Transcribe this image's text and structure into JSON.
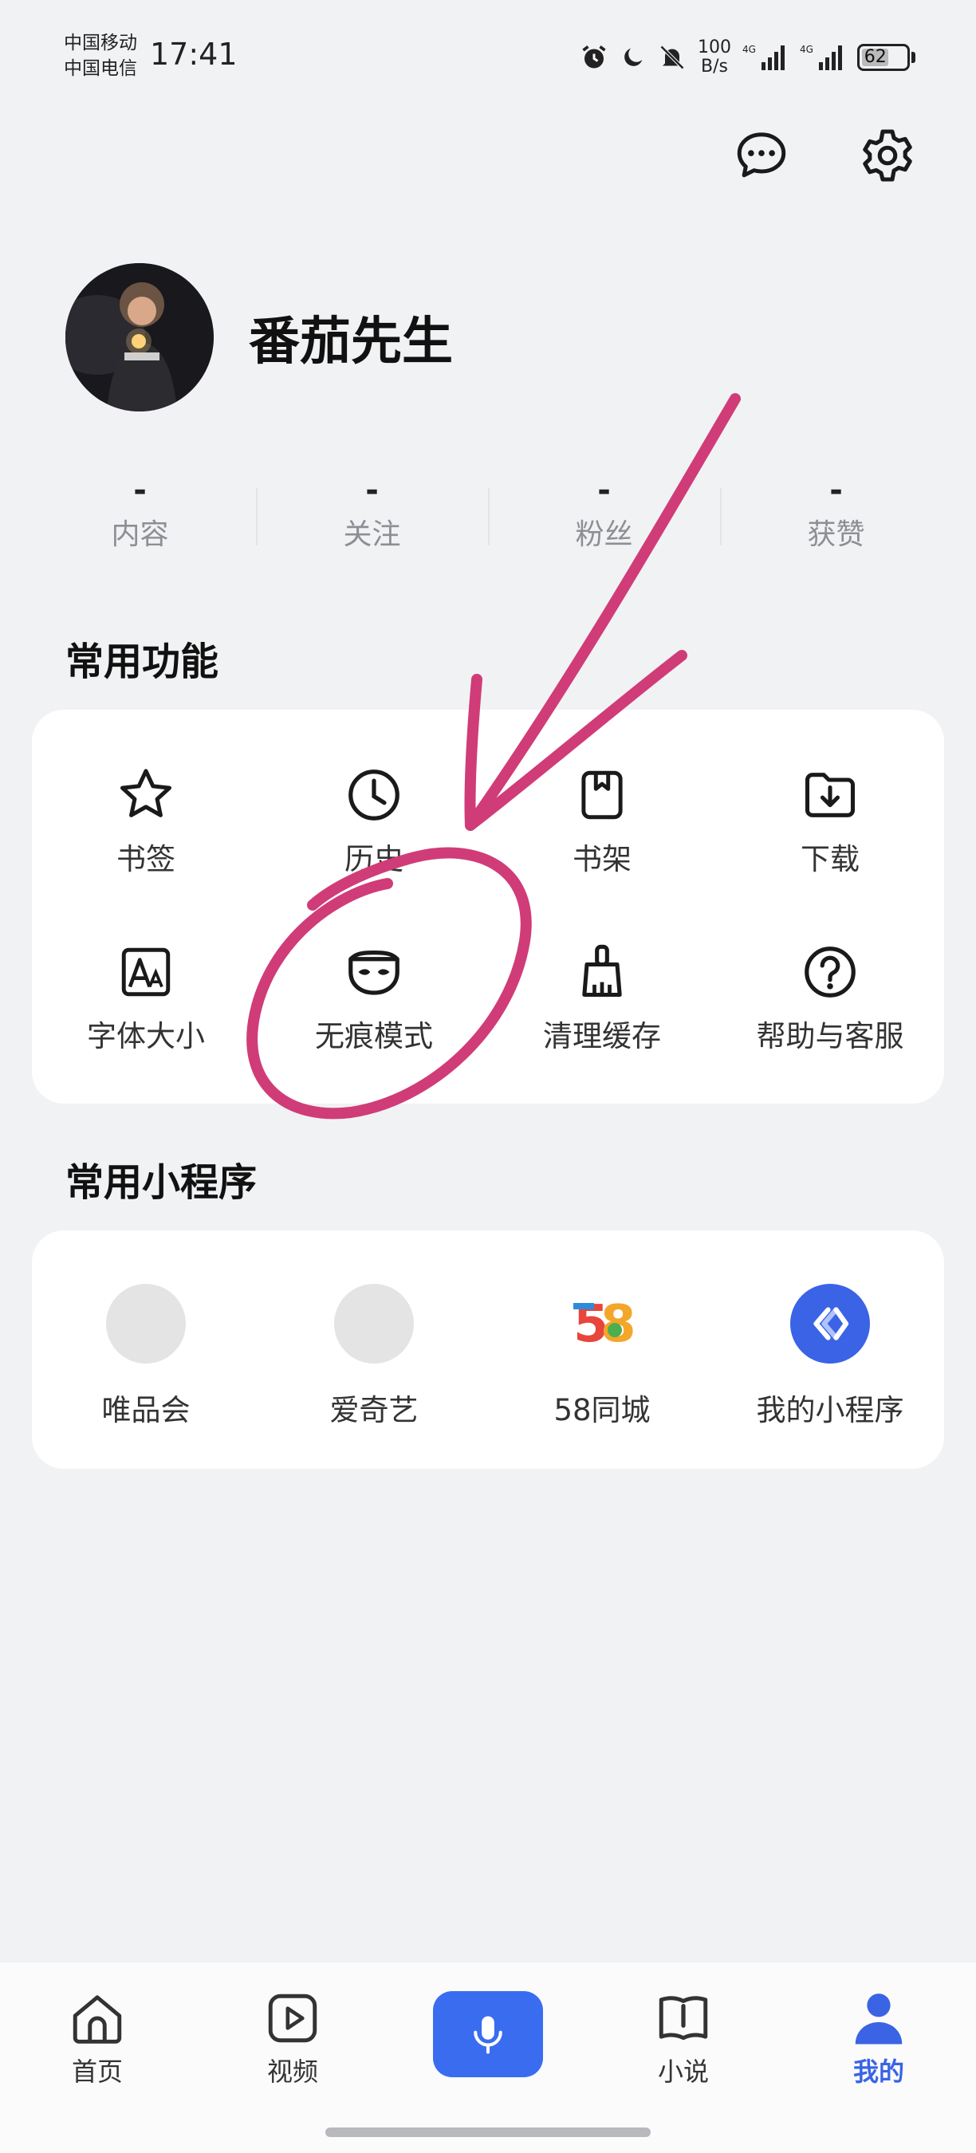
{
  "status_bar": {
    "carrier_1": "中国移动",
    "carrier_2": "中国电信",
    "time": "17:41",
    "net_speed_value": "100",
    "net_speed_unit": "B/s",
    "signal_label_1": "4G",
    "signal_label_2": "4G",
    "battery": "62"
  },
  "header": {
    "message_icon": "chat-bubble-icon",
    "settings_icon": "gear-icon"
  },
  "profile": {
    "name": "番茄先生"
  },
  "stats": [
    {
      "value": "-",
      "label": "内容"
    },
    {
      "value": "-",
      "label": "关注"
    },
    {
      "value": "-",
      "label": "粉丝"
    },
    {
      "value": "-",
      "label": "获赞"
    }
  ],
  "common_functions": {
    "title": "常用功能",
    "items": [
      {
        "label": "书签",
        "icon": "star-icon"
      },
      {
        "label": "历史",
        "icon": "clock-icon"
      },
      {
        "label": "书架",
        "icon": "bookshelf-icon"
      },
      {
        "label": "下载",
        "icon": "download-folder-icon"
      },
      {
        "label": "字体大小",
        "icon": "font-size-icon"
      },
      {
        "label": "无痕模式",
        "icon": "mask-icon"
      },
      {
        "label": "清理缓存",
        "icon": "broom-icon"
      },
      {
        "label": "帮助与客服",
        "icon": "help-icon"
      }
    ]
  },
  "mini_programs": {
    "title": "常用小程序",
    "items": [
      {
        "label": "唯品会"
      },
      {
        "label": "爱奇艺"
      },
      {
        "label": "58同城",
        "logo_text": "58"
      },
      {
        "label": "我的小程序"
      }
    ]
  },
  "bottom_nav": {
    "items": [
      {
        "label": "首页",
        "icon": "home-icon"
      },
      {
        "label": "视频",
        "icon": "video-icon"
      },
      {
        "label": "",
        "icon": "microphone-icon"
      },
      {
        "label": "小说",
        "icon": "book-icon"
      },
      {
        "label": "我的",
        "icon": "person-icon",
        "active": true
      }
    ]
  },
  "colors": {
    "accent": "#3a64e4",
    "background": "#f1f2f4",
    "annotation": "#d03c78"
  }
}
